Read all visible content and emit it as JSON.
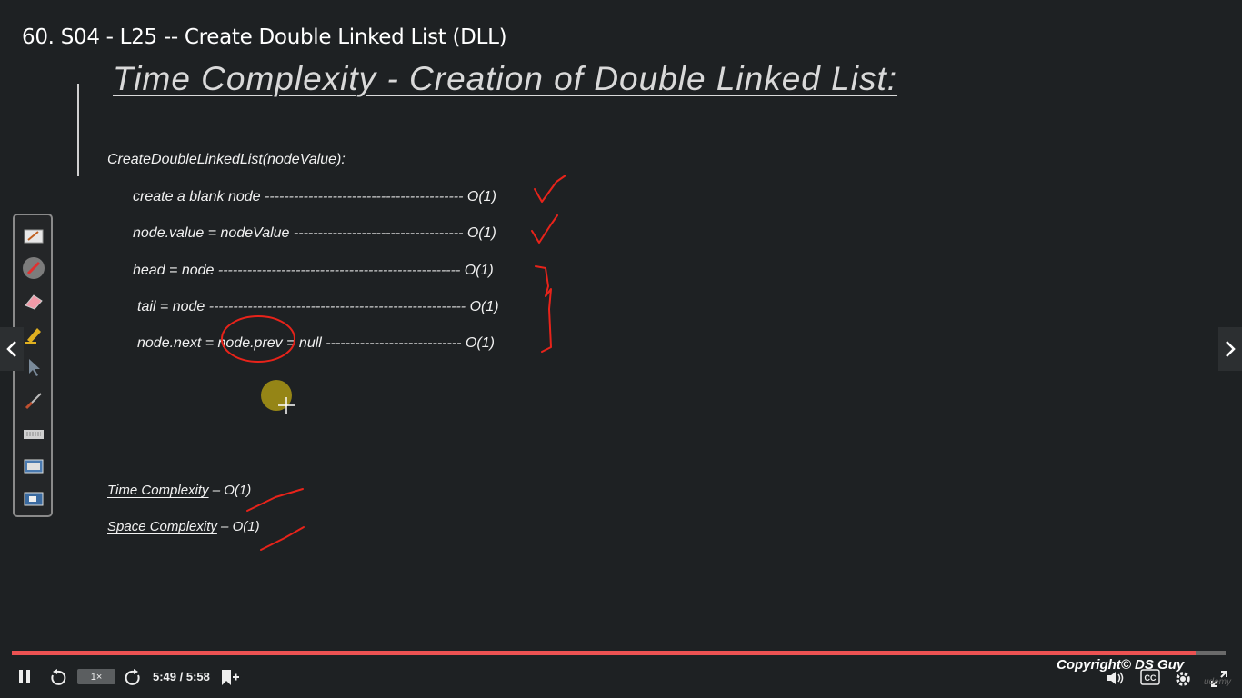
{
  "video": {
    "title": "60. S04 - L25 -- Create Double Linked List (DLL)"
  },
  "slide": {
    "heading": "Time Complexity - Creation of Double Linked List:",
    "function_signature": "CreateDoubleLinkedList(nodeValue):",
    "steps": [
      {
        "code": "create a blank node",
        "dashes": "-----------------------------------------",
        "complexity": "O(1)"
      },
      {
        "code": "node.value = nodeValue",
        "dashes": "-----------------------------------",
        "complexity": "O(1)"
      },
      {
        "code": "head = node",
        "dashes": "--------------------------------------------------",
        "complexity": "O(1)"
      },
      {
        "code": "tail = node",
        "dashes": "-----------------------------------------------------",
        "complexity": "O(1)"
      },
      {
        "code_before": "node.next = ",
        "code_circled": "node.prev",
        "code_after": " = null",
        "dashes": "----------------------------",
        "complexity": "O(1)"
      }
    ],
    "summary": [
      {
        "label": "Time Complexity",
        "separator": " – ",
        "value": "O(1)"
      },
      {
        "label": "Space Complexity",
        "separator": " – ",
        "value": "O(1)"
      }
    ],
    "annotation_color": "#e8231a"
  },
  "ink_toolbar": {
    "tools": [
      "whiteboard-icon",
      "pen-icon",
      "eraser-icon",
      "highlighter-icon",
      "pointer-icon",
      "brush-icon",
      "keyboard-icon",
      "screen-icon",
      "monitor-icon"
    ]
  },
  "player": {
    "speed": "1×",
    "current_time": "5:49",
    "separator": " / ",
    "duration": "5:58",
    "progress_fraction": 0.975,
    "accent": "#ec5252",
    "copyright": "Copyright© DS Guy",
    "watermark": "udemy"
  }
}
